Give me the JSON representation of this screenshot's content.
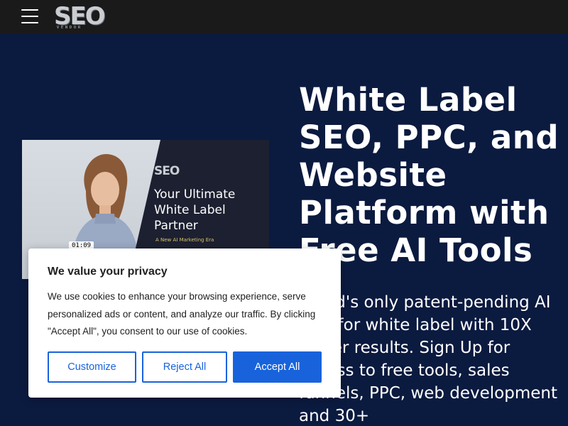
{
  "header": {
    "logo_text": "SEO",
    "logo_subtext": "VENDOR",
    "menu_icon": "hamburger-menu-icon"
  },
  "video": {
    "logo_text": "SEO",
    "title": "Your Ultimate White Label Partner",
    "tagline": "A New AI Marketing Era",
    "duration": "01:09"
  },
  "hero": {
    "headline": "White Label SEO, PPC, and Website Platform with Free AI Tools",
    "description": "World's only patent-pending AI SEO for white label with 10X better results. Sign Up for access to free tools, sales funnels, PPC, web development and 30+"
  },
  "cookie_banner": {
    "title": "We value your privacy",
    "text": "We use cookies to enhance your browsing experience, serve personalized ads or content, and analyze our traffic. By clicking \"Accept All\", you consent to our use of cookies.",
    "customize_label": "Customize",
    "reject_label": "Reject All",
    "accept_label": "Accept All"
  },
  "colors": {
    "page_bg": "#0b1a3f",
    "topbar_bg": "#1a1a1a",
    "accent_blue": "#1863dc"
  }
}
